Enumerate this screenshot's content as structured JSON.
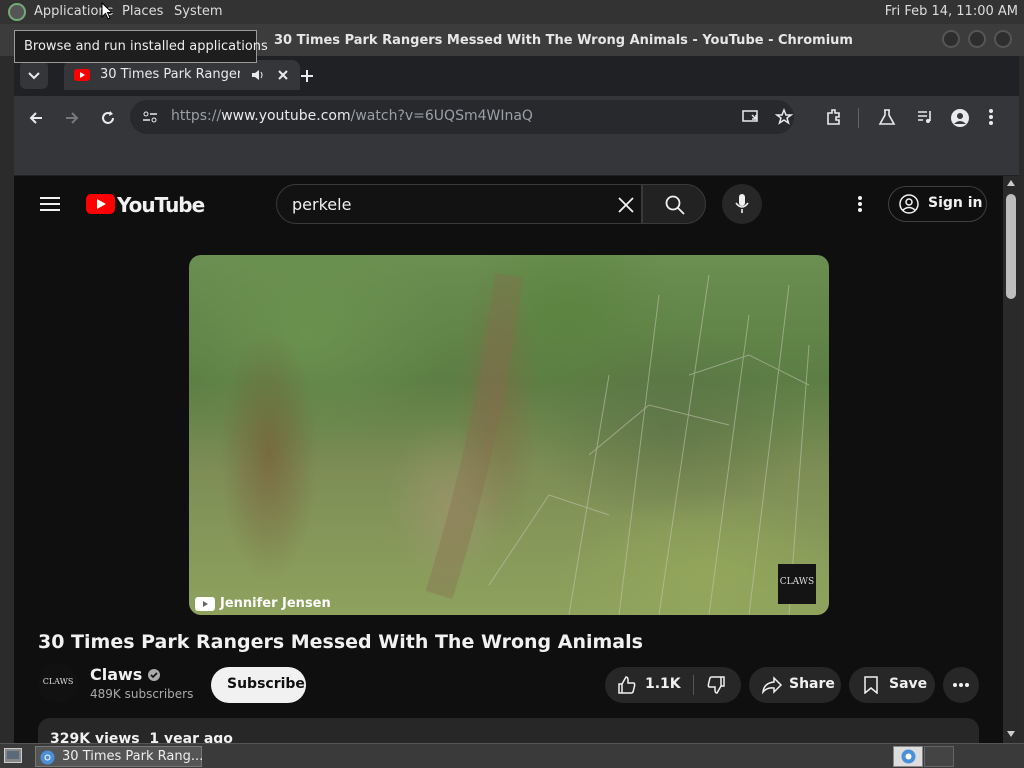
{
  "top_panel": {
    "menu_applications": "Applications",
    "menu_places": "Places",
    "menu_system": "System",
    "clock": "Fri Feb 14, 11:00 AM"
  },
  "tooltip": "Browse and run installed applications",
  "window": {
    "title": "30 Times Park Rangers Messed With The Wrong Animals - YouTube - Chromium"
  },
  "browser": {
    "tab_title": "30 Times Park Rangers M",
    "url_prefix": "https://",
    "url_host": "www.youtube.com",
    "url_path": "/watch?v=6UQSm4WInaQ"
  },
  "youtube": {
    "logo_text": "YouTube",
    "search_query": "perkele",
    "sign_in": "Sign in",
    "watermark": "Jennifer Jensen",
    "channel_logo": "CLAWS",
    "video_title": "30 Times Park Rangers Messed With The Wrong Animals",
    "channel_name": "Claws",
    "subscribers": "489K subscribers",
    "subscribe": "Subscribe",
    "likes": "1.1K",
    "share": "Share",
    "save": "Save",
    "stats": "329K views  1 year ago"
  },
  "taskbar": {
    "window_label": "30 Times Park Rang..."
  },
  "colors": {
    "youtube_red": "#ff0000",
    "link_blue": "#3ea6ff",
    "page_bg": "#0f0f0f"
  }
}
